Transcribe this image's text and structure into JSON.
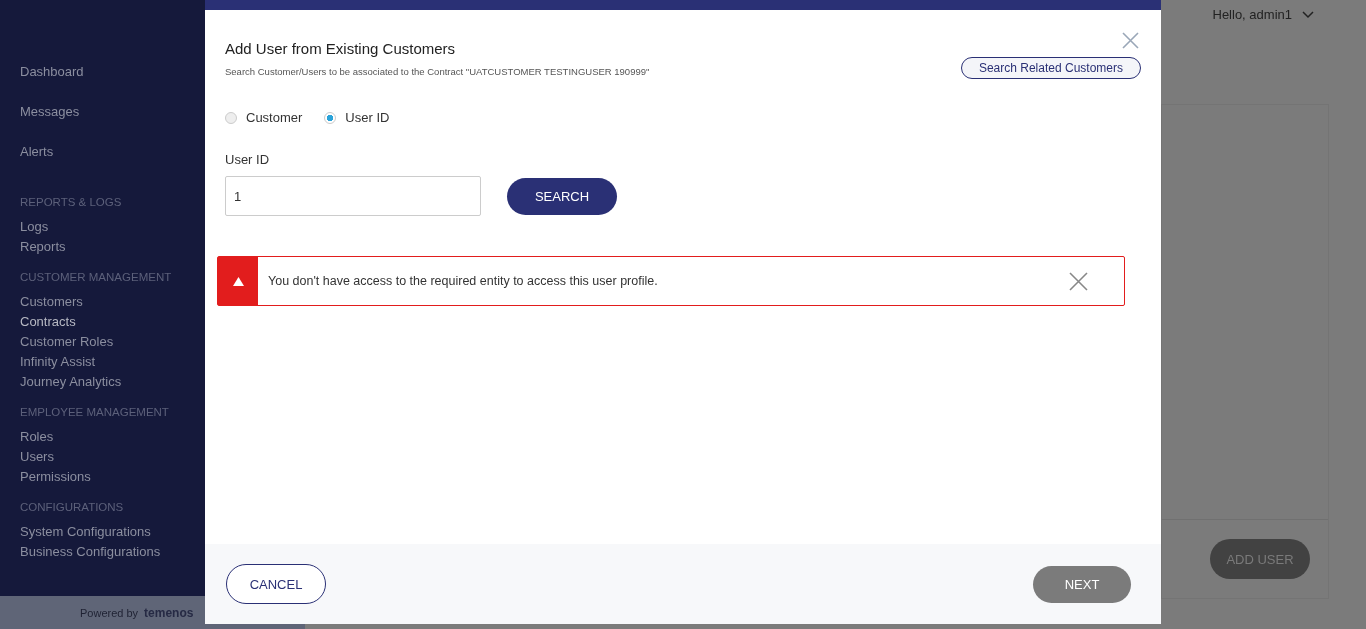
{
  "sidebar": {
    "items": [
      {
        "kind": "link",
        "label": "Dashboard",
        "selected": false
      },
      {
        "kind": "link",
        "label": "Messages",
        "selected": false
      },
      {
        "kind": "link",
        "label": "Alerts",
        "selected": false
      },
      {
        "kind": "heading",
        "label": "REPORTS & LOGS"
      },
      {
        "kind": "link",
        "label": "Logs",
        "selected": false
      },
      {
        "kind": "link",
        "label": "Reports",
        "selected": false
      },
      {
        "kind": "heading",
        "label": "CUSTOMER MANAGEMENT"
      },
      {
        "kind": "link",
        "label": "Customers",
        "selected": false
      },
      {
        "kind": "link",
        "label": "Contracts",
        "selected": true
      },
      {
        "kind": "link",
        "label": "Customer Roles",
        "selected": false
      },
      {
        "kind": "link",
        "label": "Infinity Assist",
        "selected": false
      },
      {
        "kind": "link",
        "label": "Journey Analytics",
        "selected": false
      },
      {
        "kind": "heading",
        "label": "EMPLOYEE MANAGEMENT"
      },
      {
        "kind": "link",
        "label": "Roles",
        "selected": false
      },
      {
        "kind": "link",
        "label": "Users",
        "selected": false
      },
      {
        "kind": "link",
        "label": "Permissions",
        "selected": false
      },
      {
        "kind": "heading",
        "label": "CONFIGURATIONS"
      },
      {
        "kind": "link",
        "label": "System Configurations",
        "selected": false
      },
      {
        "kind": "link",
        "label": "Business Configurations",
        "selected": false
      }
    ],
    "footer": {
      "powered_by": "Powered by",
      "brand": "temenos"
    }
  },
  "header": {
    "greeting": "Hello, admin1"
  },
  "page": {
    "add_user_button": "ADD USER"
  },
  "dialog": {
    "title": "Add User from Existing Customers",
    "subtitle": "Search Customer/Users to be associated to the Contract \"UATCUSTOMER TESTINGUSER 190999\"",
    "related_button": "Search Related Customers",
    "radios": [
      {
        "label": "Customer",
        "selected": false
      },
      {
        "label": "User ID",
        "selected": true
      }
    ],
    "field": {
      "label": "User ID",
      "value": "1"
    },
    "search_button": "SEARCH",
    "alert": {
      "message": "You don't have access to the required entity to access this user profile."
    },
    "cancel_button": "CANCEL",
    "next_button": {
      "label": "NEXT",
      "disabled": true
    }
  }
}
